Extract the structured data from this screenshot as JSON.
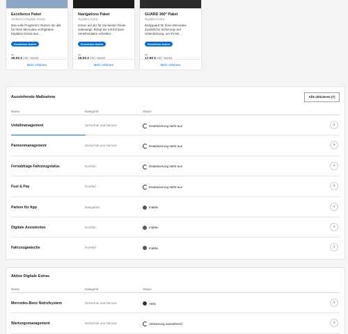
{
  "cards": [
    {
      "title": "Excellence Paket",
      "subtitle": "Umfasst 6 Digitale Extras",
      "description": "Das volle Programm: Nutzen Sie alle für Ihren Mercedes verfügbaren Digitalen Extras aus...",
      "badge": "Kostenlos testen",
      "price_prefix": "ab",
      "price": "35,00 €",
      "price_suffix": "inkl. MwSt.",
      "more": "Mehr erfahren"
    },
    {
      "title": "Navigations Paket",
      "subtitle": "Digitales Extra",
      "description": "Immer auf der für Sie besten Route unterwegs. Bringt Sie mit Echtzeit-Verkehrsdaten schneller...",
      "badge": "Kostenlos testen",
      "price_prefix": "ab",
      "price": "15,00 €",
      "price_suffix": "inkl. MwSt.",
      "more": "Mehr erfahren"
    },
    {
      "title": "GUARD 360° Paket",
      "subtitle": "Digitales Extra",
      "description": "Bodyguard für Ihren Mercedes: Zusätzliche Sicherung und Unterstützung, um Ihr bei...",
      "badge": "Kostenlos testen",
      "price_prefix": "ab",
      "price": "17,90 €",
      "price_suffix": "inkl. MwSt.",
      "more": "Mehr erfahren"
    }
  ],
  "pending": {
    "title": "Ausstehende Maßnahme",
    "activate_all": "Alle aktivieren (7)",
    "headers": {
      "name": "Name",
      "category": "Kategorie",
      "status": "Status"
    },
    "rows": [
      {
        "name": "Unfallmanagement",
        "category": "Sicherheit und Service",
        "status": "Deaktivierung steht aus",
        "icon": "pending-icon"
      },
      {
        "name": "Pannenmanagement",
        "category": "Sicherheit und Service",
        "status": "Deaktivierung steht aus",
        "icon": "pending-icon"
      },
      {
        "name": "Fernabfrage Fahrzeugstatus",
        "category": "Komfort",
        "status": "Deaktivierung steht aus",
        "icon": "pending-icon"
      },
      {
        "name": "Fuel & Pay",
        "category": "Komfort",
        "status": "Deaktivierung steht aus",
        "icon": "pending-icon"
      },
      {
        "name": "Parken für App",
        "category": "Navigation",
        "status": "Inaktiv",
        "icon": "inactive-icon"
      },
      {
        "name": "Digitale Assistenten",
        "category": "Komfort",
        "status": "Inaktiv",
        "icon": "inactive-icon"
      },
      {
        "name": "Fahrzeugwäsche",
        "category": "Komfort",
        "status": "Inaktiv",
        "icon": "inactive-icon"
      }
    ]
  },
  "active": {
    "title": "Aktive Digitale Extras",
    "headers": {
      "name": "Name",
      "category": "Kategorie",
      "status": "Status"
    },
    "rows": [
      {
        "name": "Mercedes-Benz Notrufsystem",
        "category": "Sicherheit und Service",
        "status": "Aktiv",
        "icon": "active-icon"
      },
      {
        "name": "Wartungsmanagement",
        "category": "Sicherheit und Service",
        "status": "Aktivierung ausstehend",
        "icon": "pending-icon"
      }
    ]
  },
  "chevron_glyph": "›",
  "colors": {
    "accent": "#0a6ed1"
  }
}
